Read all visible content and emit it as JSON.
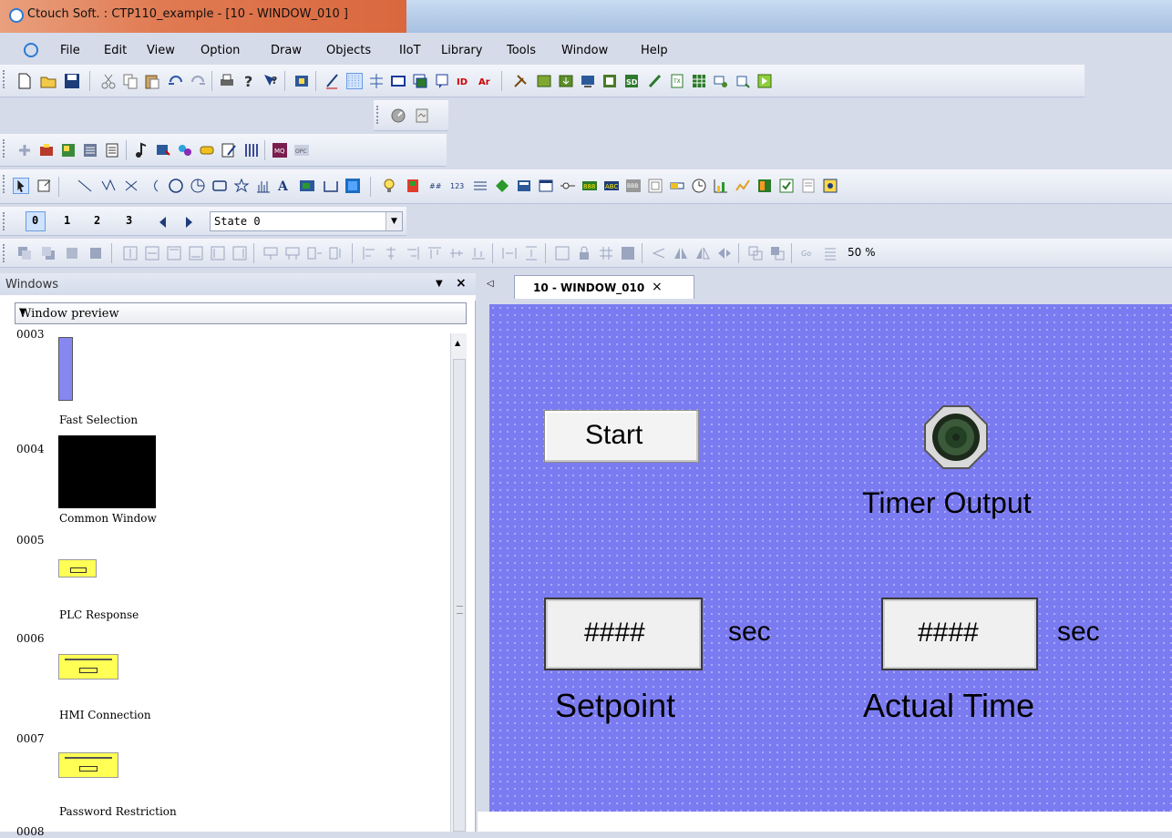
{
  "window": {
    "title": "Ctouch Soft. : CTP110_example - [10 - WINDOW_010 ]"
  },
  "menu": [
    "File",
    "Edit",
    "View",
    "Option",
    "Draw",
    "Objects",
    "IIoT",
    "Library",
    "Tools",
    "Window",
    "Help"
  ],
  "state_toolbar": {
    "states": [
      "0",
      "1",
      "2",
      "3"
    ],
    "selected_state": "State 0"
  },
  "zoom_text": "50 %",
  "windows_panel": {
    "title": "Windows",
    "preview_mode": "Window preview",
    "items": [
      {
        "num": "0003",
        "name": "Fast Selection"
      },
      {
        "num": "0004",
        "name": "Common Window"
      },
      {
        "num": "0005",
        "name": "PLC Response"
      },
      {
        "num": "0006",
        "name": "HMI Connection"
      },
      {
        "num": "0007",
        "name": "Password Restriction"
      },
      {
        "num": "0008",
        "name": ""
      }
    ]
  },
  "document_tab": {
    "label": "10 - WINDOW_010",
    "close": "×",
    "nav": "◁"
  },
  "canvas": {
    "start_button": "Start",
    "lamp_label": "Timer Output",
    "setpoint": {
      "value": "####",
      "unit": "sec",
      "label": "Setpoint"
    },
    "actual_time": {
      "value": "####",
      "unit": "sec",
      "label": "Actual Time"
    }
  },
  "colors": {
    "canvas_bg": "#7b7bf1",
    "title_accent": "#e07a52"
  },
  "icons": [
    "new-icon",
    "open-icon",
    "save-icon",
    "cut-icon",
    "copy-icon",
    "paste-icon",
    "undo-icon",
    "redo-icon",
    "print-icon",
    "help-icon",
    "pointer-help-icon",
    "pointer-icon",
    "properties-icon",
    "line-icon",
    "circle-icon",
    "rectangle-icon",
    "lamp-icon",
    "meter-icon",
    "chart-icon"
  ]
}
